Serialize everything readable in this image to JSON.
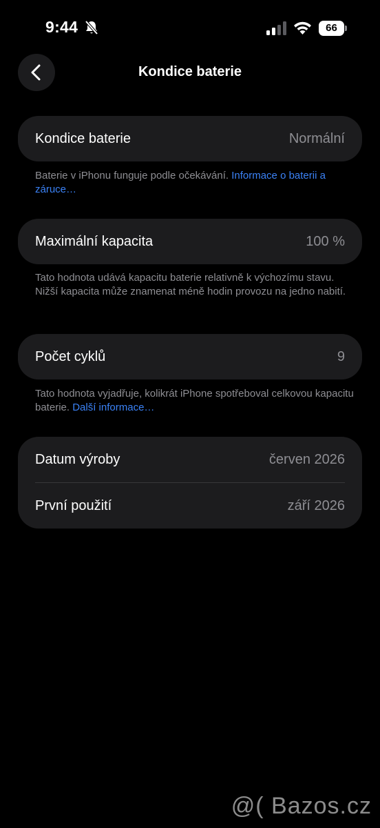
{
  "status_bar": {
    "time": "9:44",
    "battery_level": "66",
    "icons": [
      "bell-slash-icon",
      "cellular-signal-icon",
      "wifi-icon",
      "battery-icon"
    ]
  },
  "nav": {
    "title": "Kondice baterie",
    "back_icon": "chevron-left-icon"
  },
  "battery_health": {
    "label": "Kondice baterie",
    "value": "Normální",
    "footnote_text": "Baterie v iPhonu funguje podle očekávání. ",
    "footnote_link": "Informace o baterii a záruce…"
  },
  "max_capacity": {
    "label": "Maximální kapacita",
    "value": "100 %",
    "footnote_text": "Tato hodnota udává kapacitu baterie relativně k výchozímu stavu. Nižší kapacita může znamenat méně hodin provozu na jedno nabití."
  },
  "cycle_count": {
    "label": "Počet cyklů",
    "value": "9",
    "footnote_text": "Tato hodnota vyjadřuje, kolikrát iPhone spotřeboval celkovou kapacitu baterie. ",
    "footnote_link": "Další informace…"
  },
  "dates": {
    "manufacture_label": "Datum výroby",
    "manufacture_value": "červen 2026",
    "first_use_label": "První použití",
    "first_use_value": "září 2026"
  },
  "watermark": "@( Bazos.cz",
  "colors": {
    "background": "#000000",
    "card": "#1c1c1e",
    "secondary_text": "#8e8e93",
    "link": "#3b82f6"
  }
}
